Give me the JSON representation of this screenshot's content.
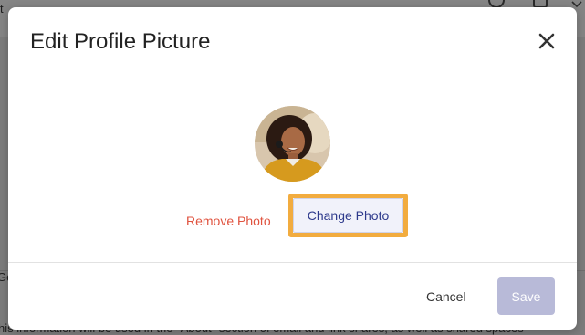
{
  "modal": {
    "title": "Edit Profile Picture",
    "remove_photo_label": "Remove Photo",
    "change_photo_label": "Change Photo",
    "cancel_label": "Cancel",
    "save_label": "Save",
    "icons": {
      "close": "close-icon",
      "avatar": "profile-avatar"
    }
  },
  "background": {
    "left_cut_text_top": "t",
    "left_cut_text_mid": "Ge",
    "bottom_text": "his information will be used in the \"About\" section of email and link shares, as well as shared spaces"
  },
  "colors": {
    "remove": "#e0533f",
    "change_text": "#2e3a8c",
    "highlight": "#f2ac3f",
    "save_disabled": "#b8bad8"
  }
}
